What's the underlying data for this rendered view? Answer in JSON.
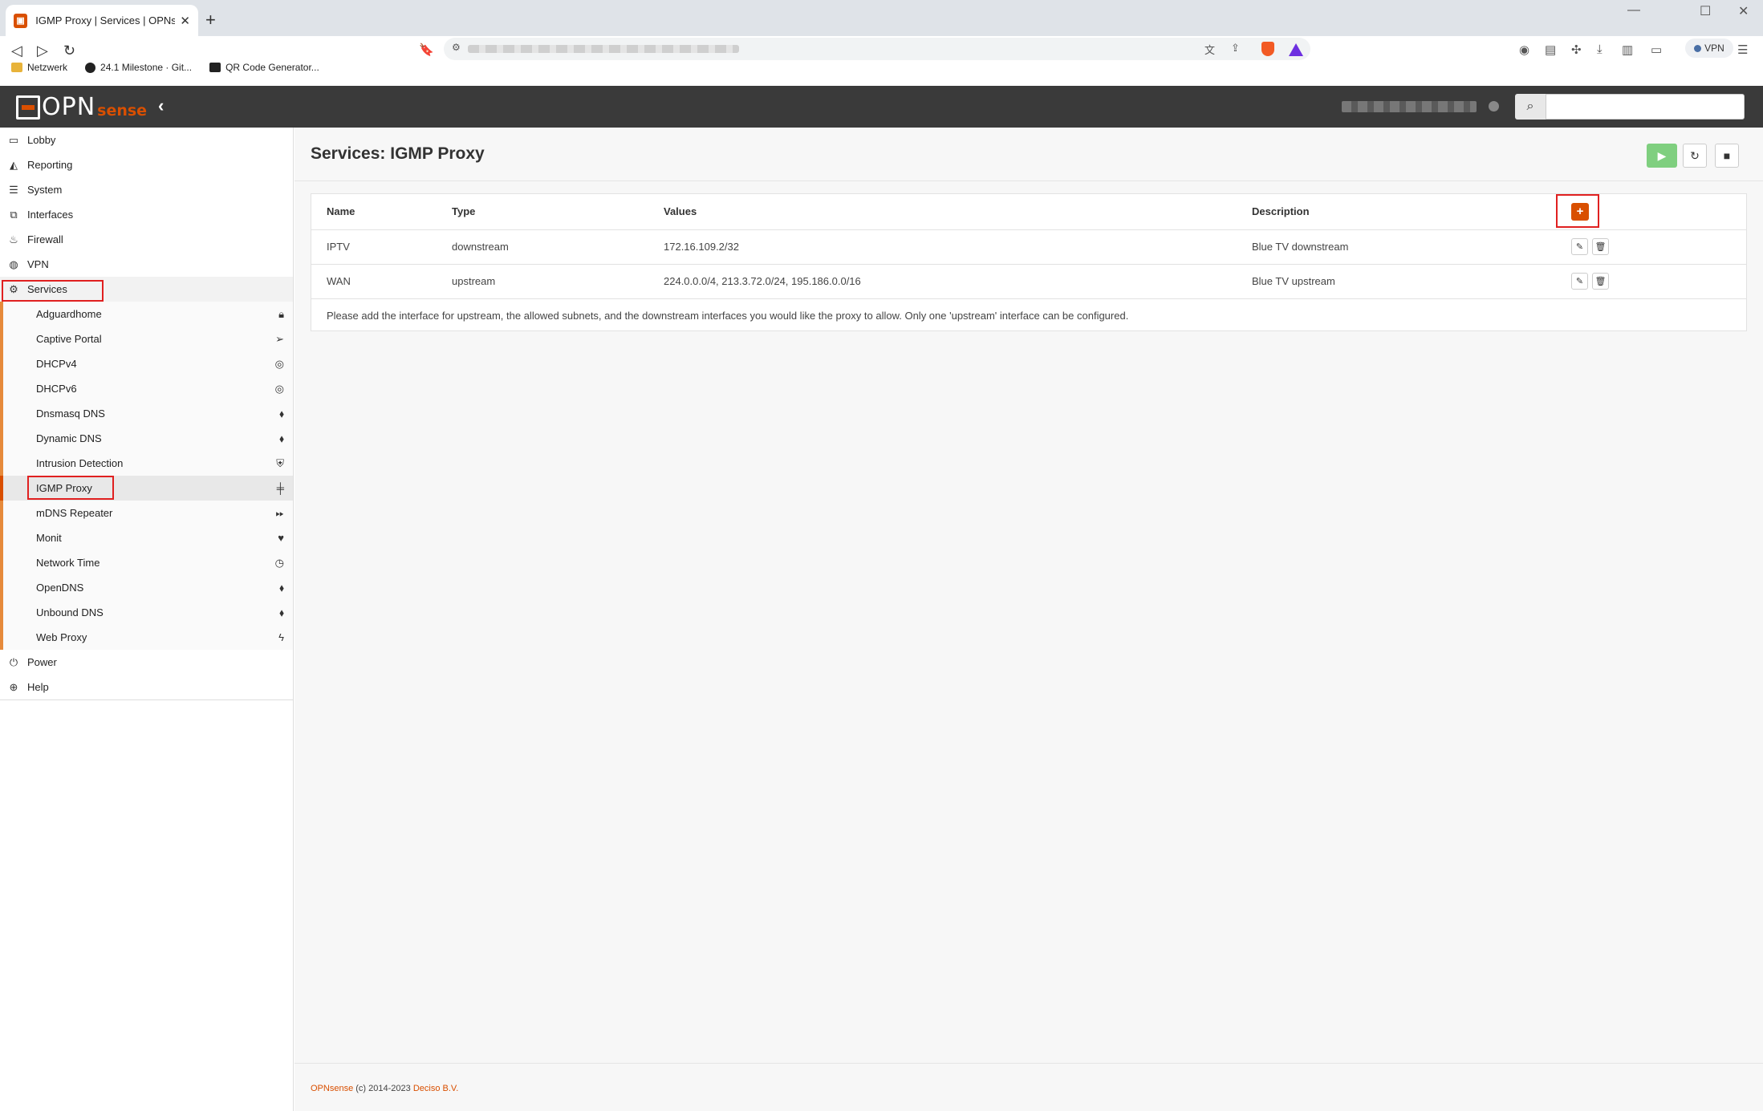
{
  "browser": {
    "tab_title": "IGMP Proxy | Services | OPNsense",
    "new_tab": "+",
    "bookmarks": [
      "Netzwerk",
      "24.1 Milestone · Git...",
      "QR Code Generator..."
    ],
    "vpn_label": "VPN"
  },
  "colors": {
    "accent": "#d94f00",
    "header": "#3a3a3a",
    "play_button": "#7fcf7f"
  },
  "sidebar": {
    "top_items": [
      {
        "label": "Lobby",
        "icon": "laptop-icon"
      },
      {
        "label": "Reporting",
        "icon": "area-chart-icon"
      },
      {
        "label": "System",
        "icon": "server-icon"
      },
      {
        "label": "Interfaces",
        "icon": "sitemap-icon"
      },
      {
        "label": "Firewall",
        "icon": "fire-icon"
      },
      {
        "label": "VPN",
        "icon": "globe-icon"
      },
      {
        "label": "Services",
        "icon": "cog-icon"
      }
    ],
    "services_items": [
      {
        "label": "Adguardhome",
        "icon": "lock-icon"
      },
      {
        "label": "Captive Portal",
        "icon": "paper-plane-icon"
      },
      {
        "label": "DHCPv4",
        "icon": "bullseye-icon"
      },
      {
        "label": "DHCPv6",
        "icon": "bullseye-icon"
      },
      {
        "label": "Dnsmasq DNS",
        "icon": "tags-icon"
      },
      {
        "label": "Dynamic DNS",
        "icon": "tags-icon"
      },
      {
        "label": "Intrusion Detection",
        "icon": "shield-icon"
      },
      {
        "label": "IGMP Proxy",
        "icon": "map-signs-icon"
      },
      {
        "label": "mDNS Repeater",
        "icon": "forward-icon"
      },
      {
        "label": "Monit",
        "icon": "heartbeat-icon"
      },
      {
        "label": "Network Time",
        "icon": "clock-icon"
      },
      {
        "label": "OpenDNS",
        "icon": "tags-icon"
      },
      {
        "label": "Unbound DNS",
        "icon": "tags-icon"
      },
      {
        "label": "Web Proxy",
        "icon": "bolt-icon"
      }
    ],
    "bottom_items": [
      {
        "label": "Power",
        "icon": "plug-icon"
      },
      {
        "label": "Help",
        "icon": "life-ring-icon"
      }
    ]
  },
  "page": {
    "title": "Services: IGMP Proxy",
    "columns": [
      "Name",
      "Type",
      "Values",
      "Description"
    ],
    "rows": [
      {
        "name": "IPTV",
        "type": "downstream",
        "values": "172.16.109.2/32",
        "description": "Blue TV downstream"
      },
      {
        "name": "WAN",
        "type": "upstream",
        "values": "224.0.0.0/4, 213.3.72.0/24, 195.186.0.0/16",
        "description": "Blue TV upstream"
      }
    ],
    "note": "Please add the interface for upstream, the allowed subnets, and the downstream interfaces you would like the proxy to allow. Only one 'upstream' interface can be configured."
  },
  "footer": {
    "brand": "OPNsense",
    "copyright": "(c) 2014-2023",
    "company": "Deciso B.V."
  }
}
